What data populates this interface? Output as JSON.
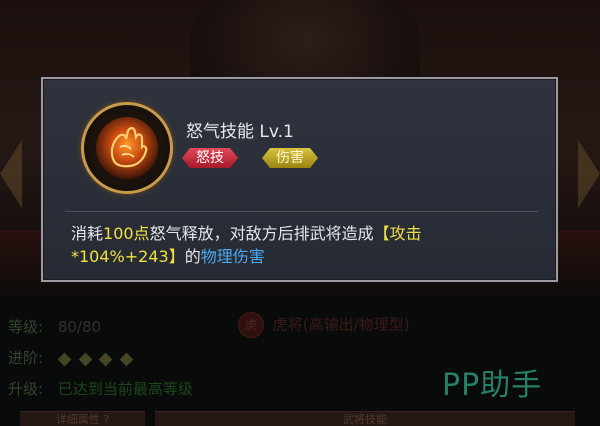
{
  "skill": {
    "title": "怒气技能 Lv.1",
    "icon": "flaming-fist-icon",
    "tags": [
      {
        "label": "怒技",
        "color": "#c82838"
      },
      {
        "label": "伤害",
        "color": "#c8b020"
      }
    ],
    "description": {
      "part1": "消耗",
      "rage_amount": "100点",
      "part2": "怒气释放，对敌方后排武将造成",
      "attack_formula_line1": "【攻击",
      "attack_formula_line2": "*104%+243】",
      "part3": "的",
      "damage_type": "物理伤害"
    }
  },
  "background": {
    "level_label": "等级:",
    "level_value": "80/80",
    "rank_label": "进阶:",
    "rank_stars": 4,
    "upgrade_label": "升级:",
    "upgrade_value": "已达到当前最高等级",
    "hero_type": "虎将(高输出/物理型)",
    "tabs": [
      "详细属性 ?",
      "武将技能"
    ]
  },
  "watermark": "PP助手",
  "colors": {
    "highlight_yellow": "#f0e040",
    "highlight_blue": "#4aa8f0",
    "watermark": "#3cc2a2"
  }
}
